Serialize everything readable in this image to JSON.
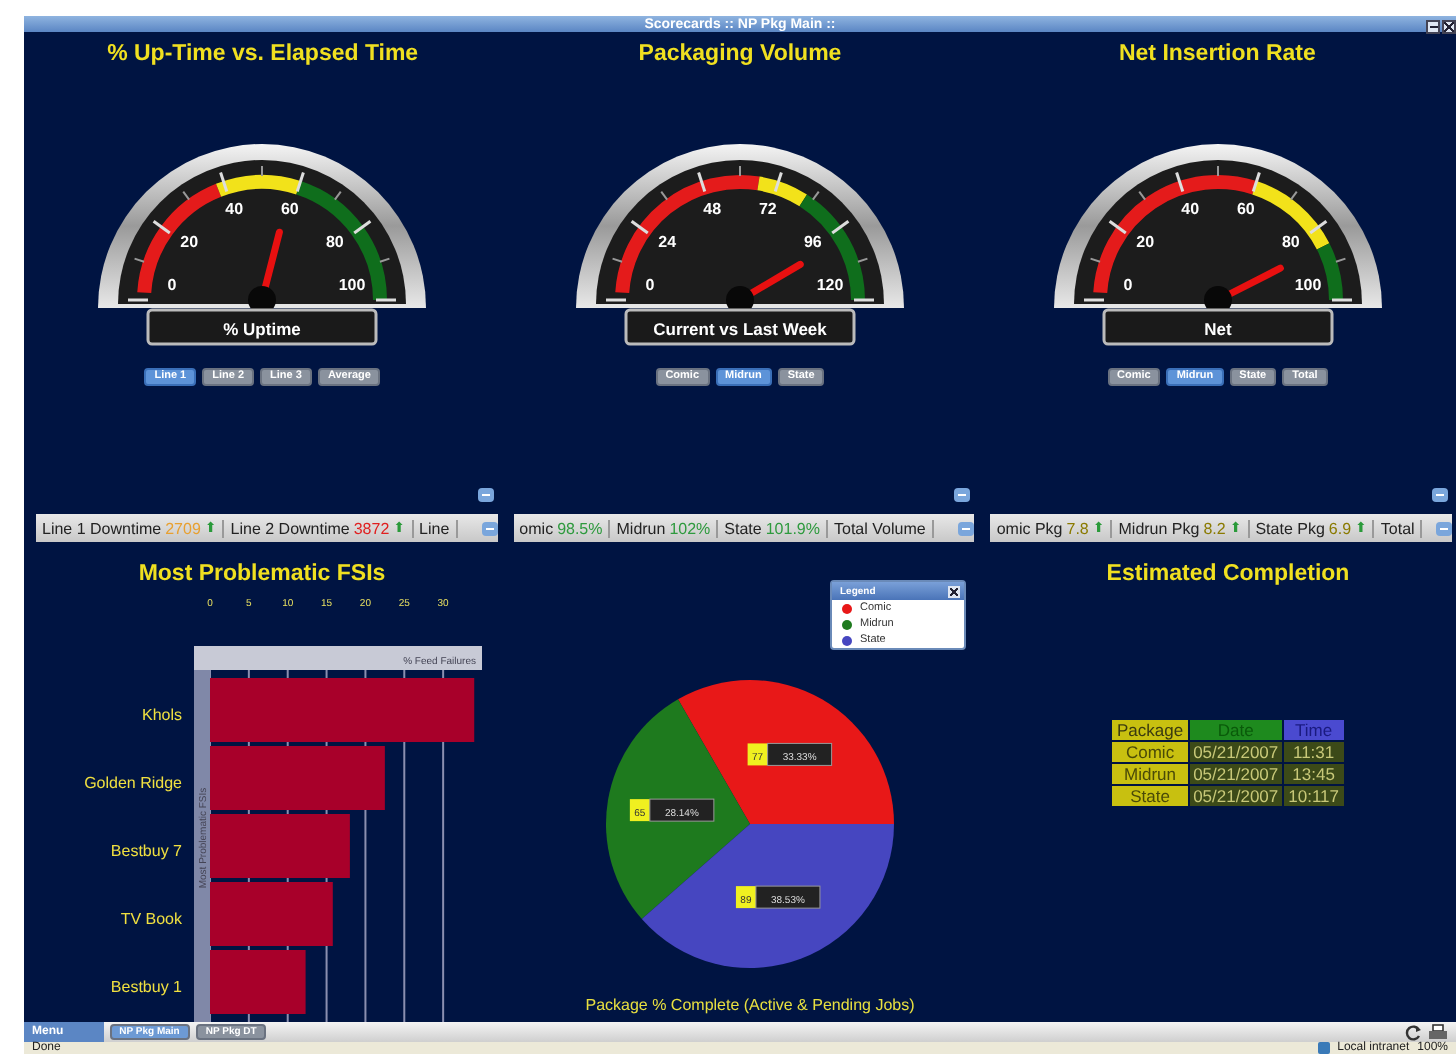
{
  "window": {
    "title": "Scorecards :: NP Pkg Main ::"
  },
  "gauges": [
    {
      "title": "% Up-Time vs. Elapsed Time",
      "caption": "% Uptime",
      "scale": [
        "0",
        "20",
        "40",
        "60",
        "80",
        "100"
      ],
      "buttons": [
        {
          "label": "Line 1",
          "selected": true
        },
        {
          "label": "Line 2",
          "selected": false
        },
        {
          "label": "Line 3",
          "selected": false
        },
        {
          "label": "Average",
          "selected": false
        }
      ],
      "ticker": [
        {
          "label": "Line 1 Downtime",
          "value": "2709",
          "color": "#e8a030",
          "arrow": "⬆"
        },
        {
          "label": "Line 2 Downtime",
          "value": "3872",
          "color": "#e02020",
          "arrow": "⬆"
        },
        {
          "label": "Line"
        }
      ]
    },
    {
      "title": "Packaging Volume",
      "caption": "Current vs Last Week",
      "scale": [
        "0",
        "24",
        "48",
        "72",
        "96",
        "120"
      ],
      "buttons": [
        {
          "label": "Comic",
          "selected": false
        },
        {
          "label": "Midrun",
          "selected": true
        },
        {
          "label": "State",
          "selected": false
        }
      ],
      "ticker": [
        {
          "label": "omic",
          "value": "98.5%",
          "color": "#2e9a3e"
        },
        {
          "label": "Midrun",
          "value": "102%",
          "color": "#2e9a3e"
        },
        {
          "label": "State",
          "value": "101.9%",
          "color": "#2e9a3e"
        },
        {
          "label": "Total Volume"
        }
      ]
    },
    {
      "title": "Net Insertion Rate",
      "caption": "Net",
      "scale": [
        "0",
        "20",
        "40",
        "60",
        "80",
        "100"
      ],
      "buttons": [
        {
          "label": "Comic",
          "selected": false
        },
        {
          "label": "Midrun",
          "selected": true
        },
        {
          "label": "State",
          "selected": false
        },
        {
          "label": "Total",
          "selected": false
        }
      ],
      "ticker": [
        {
          "label": "omic Pkg",
          "value": "7.8",
          "color": "#8a7a00",
          "arrow": "⬆"
        },
        {
          "label": "Midrun Pkg",
          "value": "8.2",
          "color": "#8a7a00",
          "arrow": "⬆"
        },
        {
          "label": "State Pkg",
          "value": "6.9",
          "color": "#8a7a00",
          "arrow": "⬆"
        },
        {
          "label": "Total"
        }
      ]
    }
  ],
  "fsi": {
    "chart_data": {
      "type": "bar",
      "orientation": "horizontal",
      "title": "Most Problematic FSIs",
      "ylabel": "Most Problematic FSIs",
      "categories": [
        "Khols",
        "Golden Ridge",
        "Bestbuy 7",
        "TV Book",
        "Bestbuy 1"
      ],
      "xlim": [
        0,
        35
      ],
      "xticks": [
        0,
        5,
        10,
        15,
        20,
        25,
        30
      ],
      "grid": true,
      "series": [
        {
          "name": "% Feed Failures",
          "color": "#a8002a",
          "values": [
            34,
            22.5,
            18,
            15.8,
            12.3
          ]
        }
      ]
    }
  },
  "package": {
    "legend": {
      "title": "Legend",
      "items": [
        {
          "label": "Comic",
          "color": "#e81818"
        },
        {
          "label": "Midrun",
          "color": "#1e7a1e"
        },
        {
          "label": "State",
          "color": "#4646c0"
        }
      ]
    },
    "chart_data": {
      "type": "pie",
      "title": "Package % Complete (Active & Pending Jobs)",
      "values": [
        33.33,
        28.14,
        38.53
      ],
      "data_labels": true,
      "value_labels": [
        "33.33%",
        "28.14%",
        "38.53%"
      ]
    },
    "counts": [
      "77",
      "65",
      "89"
    ]
  },
  "completion": {
    "title": "Estimated Completion",
    "columns": [
      "Package",
      "Date",
      "Time"
    ],
    "rows": [
      [
        "Comic",
        "05/21/2007",
        "11:31"
      ],
      [
        "Midrun",
        "05/21/2007",
        "13:45"
      ],
      [
        "State",
        "05/21/2007",
        "10:117"
      ]
    ]
  },
  "taskbar": {
    "menu": "Menu",
    "tabs": [
      {
        "label": "NP Pkg Main",
        "selected": true
      },
      {
        "label": "NP Pkg DT",
        "selected": false
      }
    ]
  },
  "status_bar": {
    "text": "Done",
    "zone": "Local intranet",
    "zoom": "100%"
  }
}
